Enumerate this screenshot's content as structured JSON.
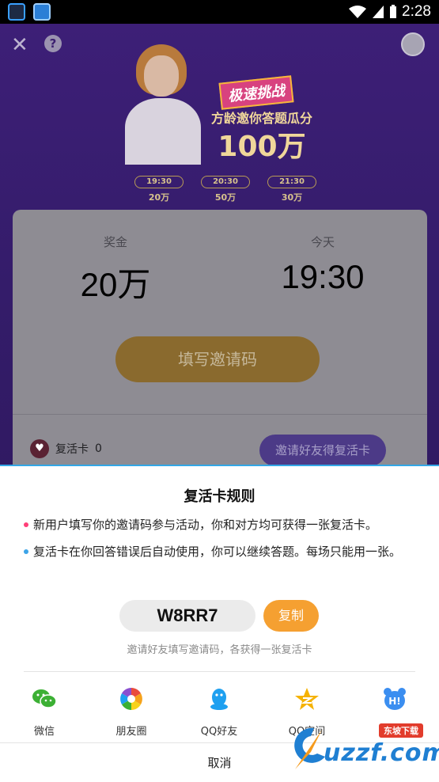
{
  "status_bar": {
    "time": "2:28"
  },
  "banner": {
    "logo_text": "极速挑战",
    "tagline": "方龄邀你答题瓜分",
    "prize": "100万",
    "sessions": [
      {
        "time": "19:30",
        "amount": "20万"
      },
      {
        "time": "20:30",
        "amount": "50万"
      },
      {
        "time": "21:30",
        "amount": "30万"
      }
    ]
  },
  "card": {
    "prize_label": "奖金",
    "prize_value": "20万",
    "today_label": "今天",
    "today_value": "19:30",
    "fill_code_button": "填写邀请码",
    "revive_label": "复活卡",
    "revive_count": "0",
    "invite_button": "邀请好友得复活卡"
  },
  "sheet": {
    "title": "复活卡规则",
    "rules": [
      "新用户填写你的邀请码参与活动，你和对方均可获得一张复活卡。",
      "复活卡在你回答错误后自动使用，你可以继续答题。每场只能用一张。"
    ],
    "invite_code": "W8RR7",
    "copy_button": "复制",
    "hint": "邀请好友填写邀请码，各获得一张复活卡",
    "share_targets": [
      {
        "label": "微信",
        "icon": "wechat-icon",
        "color": "#3cb034"
      },
      {
        "label": "朋友圈",
        "icon": "moments-icon",
        "color": "#e94b3c"
      },
      {
        "label": "QQ好友",
        "icon": "qq-icon",
        "color": "#1ea0f0"
      },
      {
        "label": "QQ空间",
        "icon": "qzone-icon",
        "color": "#f5b200"
      },
      {
        "label": "百度hi",
        "icon": "baidu-hi-icon",
        "color": "#3b8ef0"
      }
    ],
    "cancel": "取消"
  },
  "watermark": {
    "text": "uzzf.com",
    "tag": "东坡下载"
  }
}
